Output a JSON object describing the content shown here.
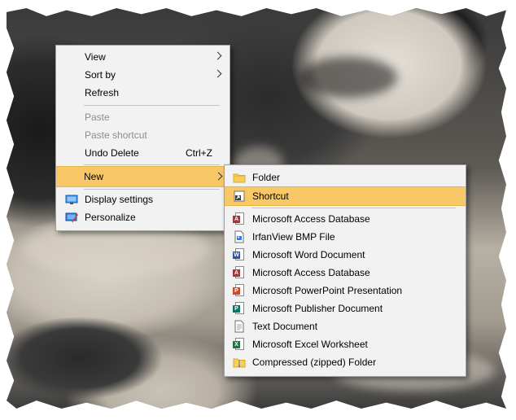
{
  "context_menu": {
    "items": [
      {
        "label": "View"
      },
      {
        "label": "Sort by"
      },
      {
        "label": "Refresh"
      },
      {
        "label": "Paste"
      },
      {
        "label": "Paste shortcut"
      },
      {
        "label": "Undo Delete",
        "shortcut": "Ctrl+Z"
      },
      {
        "label": "New"
      },
      {
        "label": "Display settings"
      },
      {
        "label": "Personalize"
      }
    ]
  },
  "new_submenu": {
    "items": [
      {
        "label": "Folder",
        "icon": "folder-icon"
      },
      {
        "label": "Shortcut",
        "icon": "shortcut-icon"
      },
      {
        "label": "Microsoft Access Database",
        "icon": "access-icon"
      },
      {
        "label": "IrfanView BMP File",
        "icon": "bmp-file-icon"
      },
      {
        "label": "Microsoft Word Document",
        "icon": "word-icon"
      },
      {
        "label": "Microsoft Access Database",
        "icon": "access-icon"
      },
      {
        "label": "Microsoft PowerPoint Presentation",
        "icon": "powerpoint-icon"
      },
      {
        "label": "Microsoft Publisher Document",
        "icon": "publisher-icon"
      },
      {
        "label": "Text Document",
        "icon": "text-document-icon"
      },
      {
        "label": "Microsoft Excel Worksheet",
        "icon": "excel-icon"
      },
      {
        "label": "Compressed (zipped) Folder",
        "icon": "zip-folder-icon"
      }
    ]
  },
  "colors": {
    "menu_background": "#f2f2f2",
    "highlight": "#f9c866",
    "disabled_text": "#8d8d8d"
  }
}
